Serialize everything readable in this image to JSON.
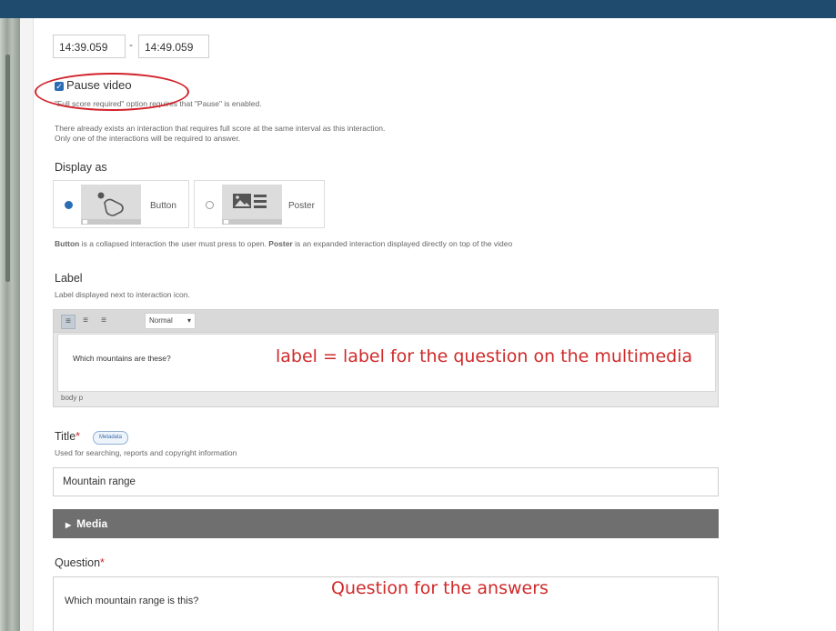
{
  "display_time": {
    "start": "14:39.059",
    "separator": "-",
    "end": "14:49.059"
  },
  "pause": {
    "checked": true,
    "label": "Pause video",
    "note": "\"Full score required\" option requires that \"Pause\" is enabled.",
    "warning_line1": "There already exists an interaction that requires full score at the same interval as this interaction.",
    "warning_line2": "Only one of the interactions will be required to answer."
  },
  "display_as": {
    "heading": "Display as",
    "options": [
      {
        "label": "Button",
        "selected": true
      },
      {
        "label": "Poster",
        "selected": false
      }
    ],
    "description": {
      "b1": "Button",
      "t1": " is a collapsed interaction the user must press to open. ",
      "b2": "Poster",
      "t2": " is an expanded interaction displayed directly on top of the video"
    }
  },
  "label_section": {
    "heading": "Label",
    "description": "Label displayed next to interaction icon.",
    "format": "Normal",
    "content": "Which mountains are these?",
    "footer_path": "body  p"
  },
  "annotations": {
    "label": "label = label for the question on the multimedia",
    "question": "Question for the answers",
    "color": "#d02a2a"
  },
  "title_section": {
    "heading": "Title",
    "required_mark": "*",
    "metadata_badge": "Metadata",
    "description": "Used for searching, reports and copyright information",
    "value": "Mountain range"
  },
  "media": {
    "label": "Media"
  },
  "question_section": {
    "heading": "Question",
    "required_mark": "*",
    "value": "Which mountain range is this?"
  },
  "colors": {
    "topbar": "#1f4b6e",
    "accent": "#2a6db5",
    "media_bar": "#6f6f6f"
  }
}
